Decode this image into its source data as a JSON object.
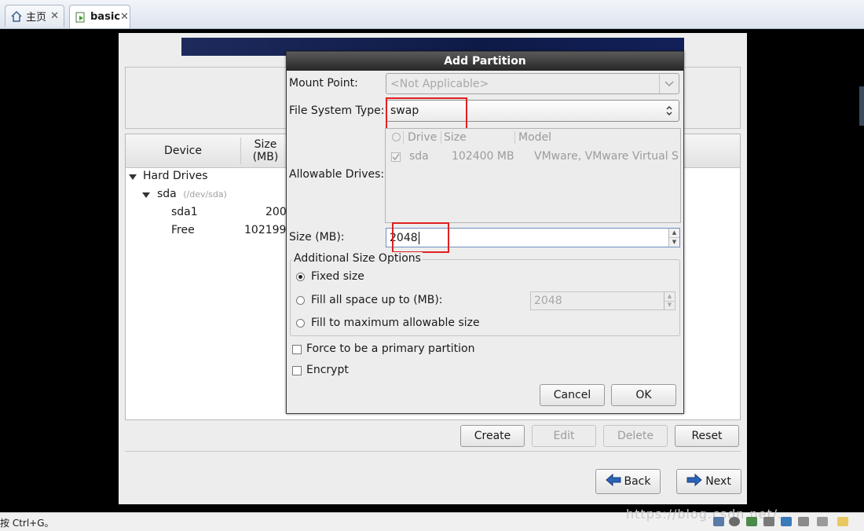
{
  "host": {
    "tabs": [
      {
        "label": "主页",
        "icon": "home-icon"
      },
      {
        "label": "basic",
        "icon": "vm-icon"
      }
    ],
    "close_glyph": "✕",
    "status_text": "按 Ctrl+G。",
    "watermark": "https://blog.csdn.net/..."
  },
  "installer": {
    "device_table": {
      "headers": {
        "device": "Device",
        "size": "Size\n(MB)"
      },
      "groups": [
        {
          "label": "Hard Drives"
        },
        {
          "label": "sda",
          "sublabel": "(/dev/sda)"
        }
      ],
      "rows": [
        {
          "device": "sda1",
          "size": "200"
        },
        {
          "device": "Free",
          "size": "102199"
        }
      ]
    },
    "buttons": {
      "create": "Create",
      "edit": "Edit",
      "delete": "Delete",
      "reset": "Reset",
      "back": "Back",
      "next": "Next"
    }
  },
  "dialog": {
    "title": "Add Partition",
    "mount_point": {
      "label": "Mount Point:",
      "value": "<Not Applicable>"
    },
    "fs_type": {
      "label": "File System Type:",
      "value": "swap"
    },
    "allowable_drives": {
      "label": "Allowable Drives:",
      "headers": [
        "Drive",
        "Size",
        "Model"
      ],
      "rows": [
        {
          "checked": true,
          "drive": "sda",
          "size": "102400 MB",
          "model": "VMware, VMware Virtual S"
        }
      ]
    },
    "size": {
      "label": "Size (MB):",
      "value": "2048"
    },
    "additional": {
      "legend": "Additional Size Options",
      "fixed": "Fixed size",
      "fill_up_to": "Fill all space up to (MB):",
      "fill_up_to_value": "2048",
      "fill_max": "Fill to maximum allowable size",
      "selected": "fixed"
    },
    "force_primary": {
      "label": "Force to be a primary partition",
      "checked": false
    },
    "encrypt": {
      "label": "Encrypt",
      "checked": false
    },
    "cancel": "Cancel",
    "ok": "OK"
  },
  "colors": {
    "highlight": "#e02020",
    "title_bar": "#2f2f2f",
    "banner": "#1b2858"
  }
}
